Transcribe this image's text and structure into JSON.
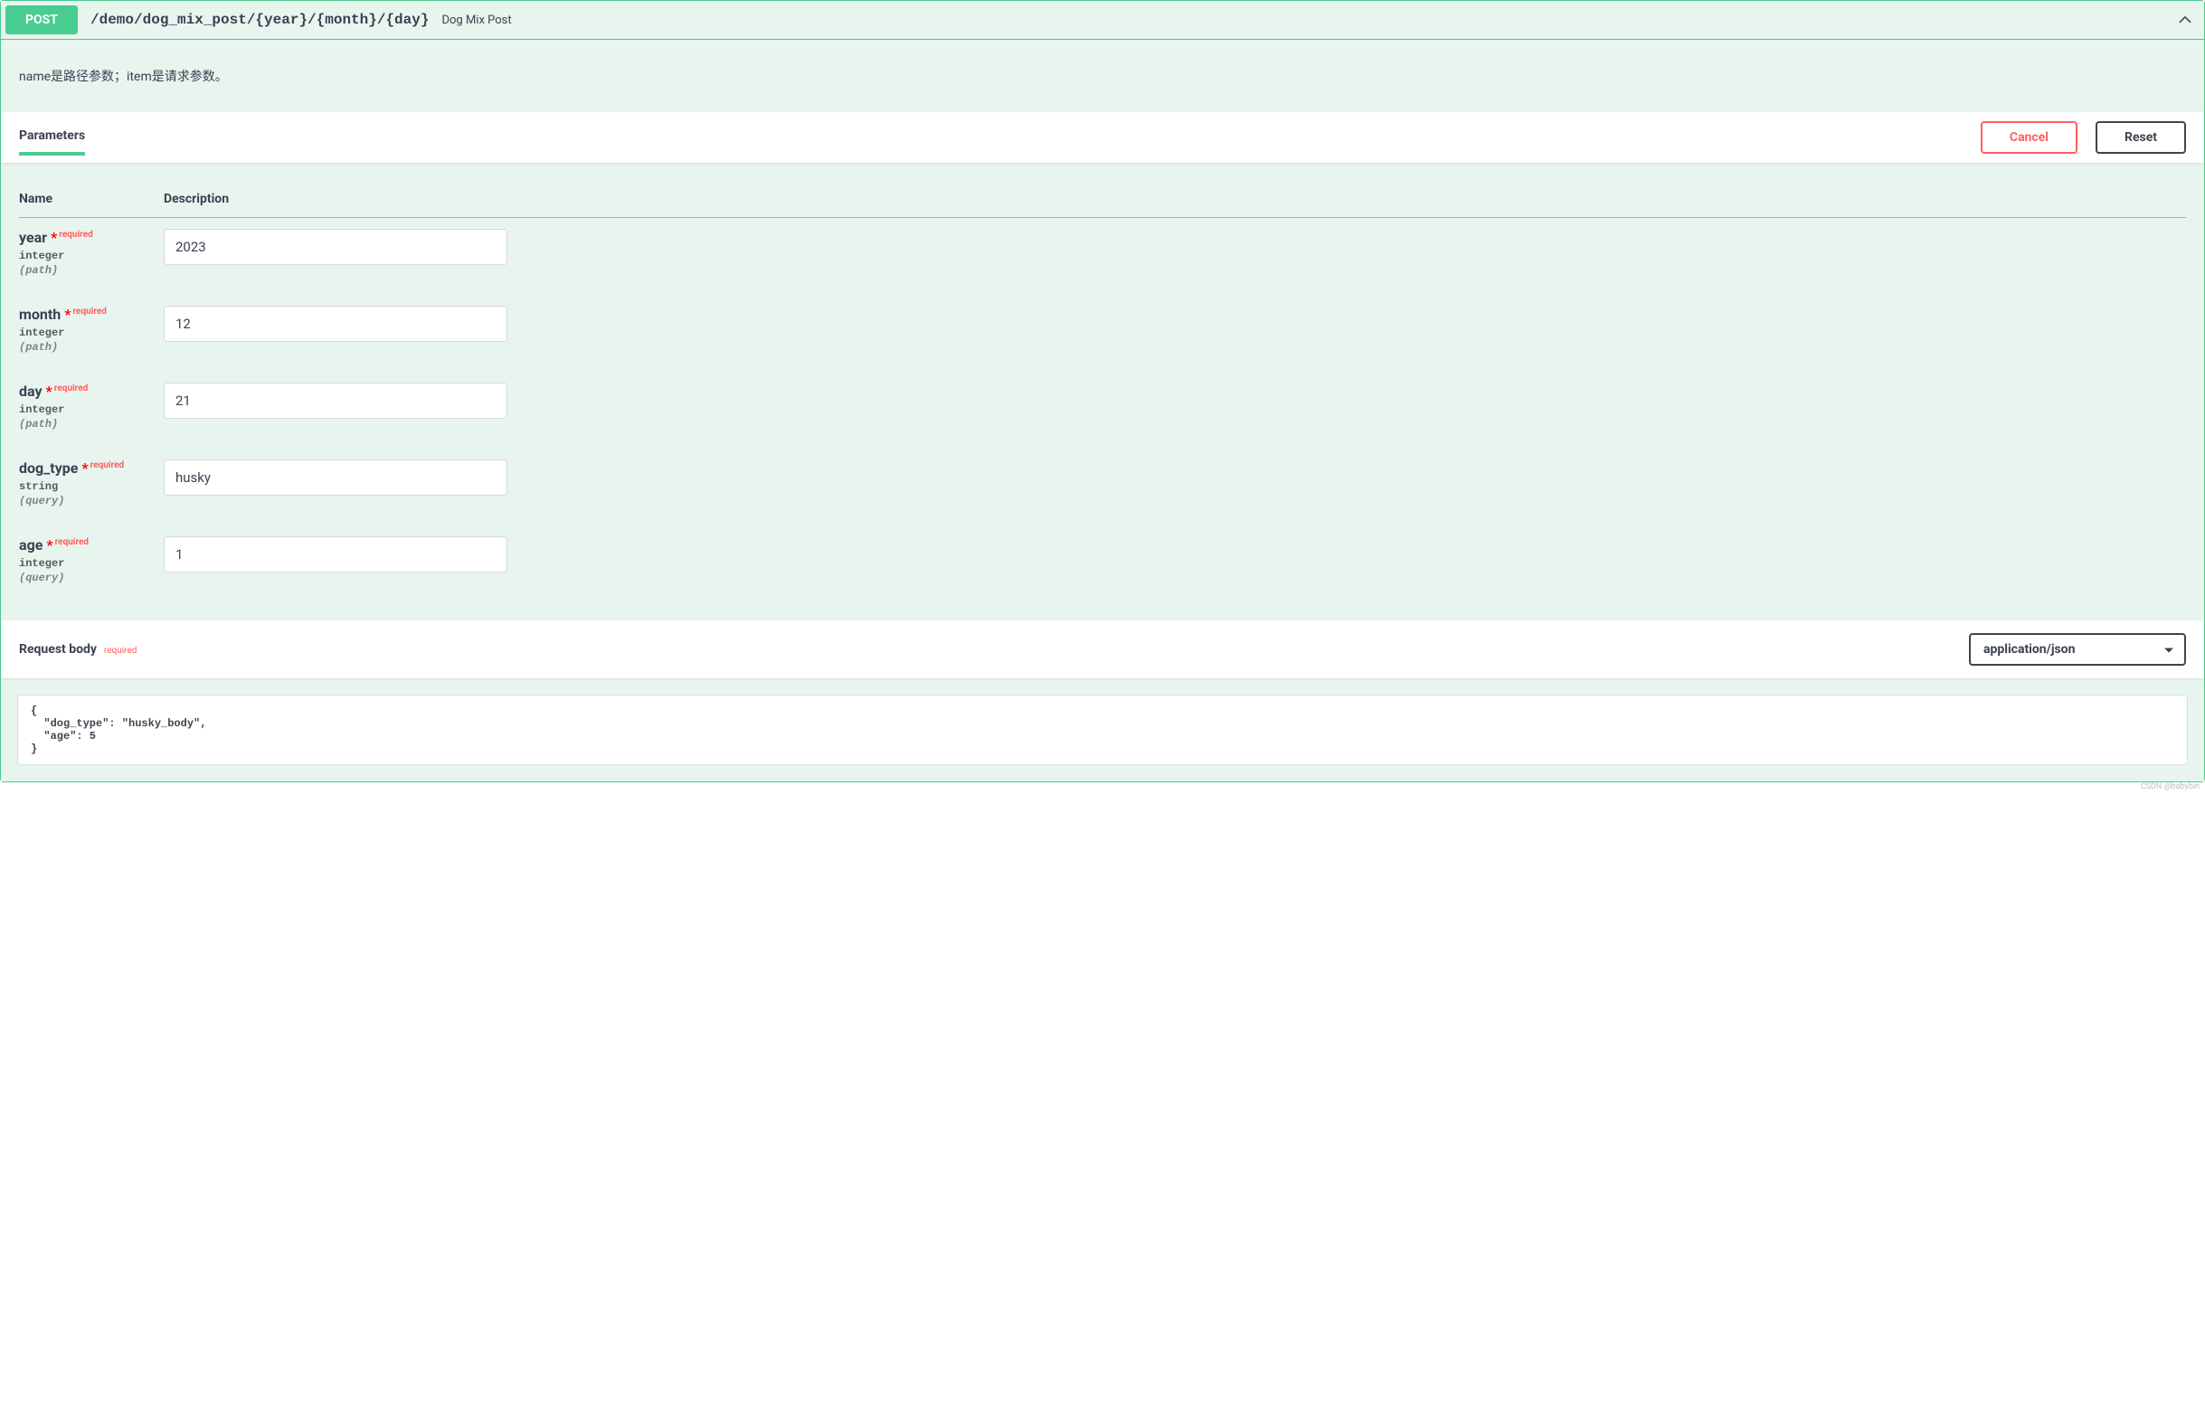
{
  "summary": {
    "method": "POST",
    "path": "/demo/dog_mix_post/{year}/{month}/{day}",
    "description": "Dog Mix Post"
  },
  "description": "name是路径参数；item是请求参数。",
  "section": {
    "parameters_title": "Parameters",
    "cancel_label": "Cancel",
    "reset_label": "Reset",
    "col_name": "Name",
    "col_description": "Description"
  },
  "parameters": [
    {
      "name": "year",
      "required": "required",
      "type": "integer",
      "in": "(path)",
      "value": "2023"
    },
    {
      "name": "month",
      "required": "required",
      "type": "integer",
      "in": "(path)",
      "value": "12"
    },
    {
      "name": "day",
      "required": "required",
      "type": "integer",
      "in": "(path)",
      "value": "21"
    },
    {
      "name": "dog_type",
      "required": "required",
      "type": "string",
      "in": "(query)",
      "value": "husky"
    },
    {
      "name": "age",
      "required": "required",
      "type": "integer",
      "in": "(query)",
      "value": "1"
    }
  ],
  "request_body": {
    "title": "Request body",
    "required": "required",
    "content_type": "application/json",
    "content": "{\n  \"dog_type\": \"husky_body\",\n  \"age\": 5\n}"
  },
  "watermark": "CSDN @babybin"
}
